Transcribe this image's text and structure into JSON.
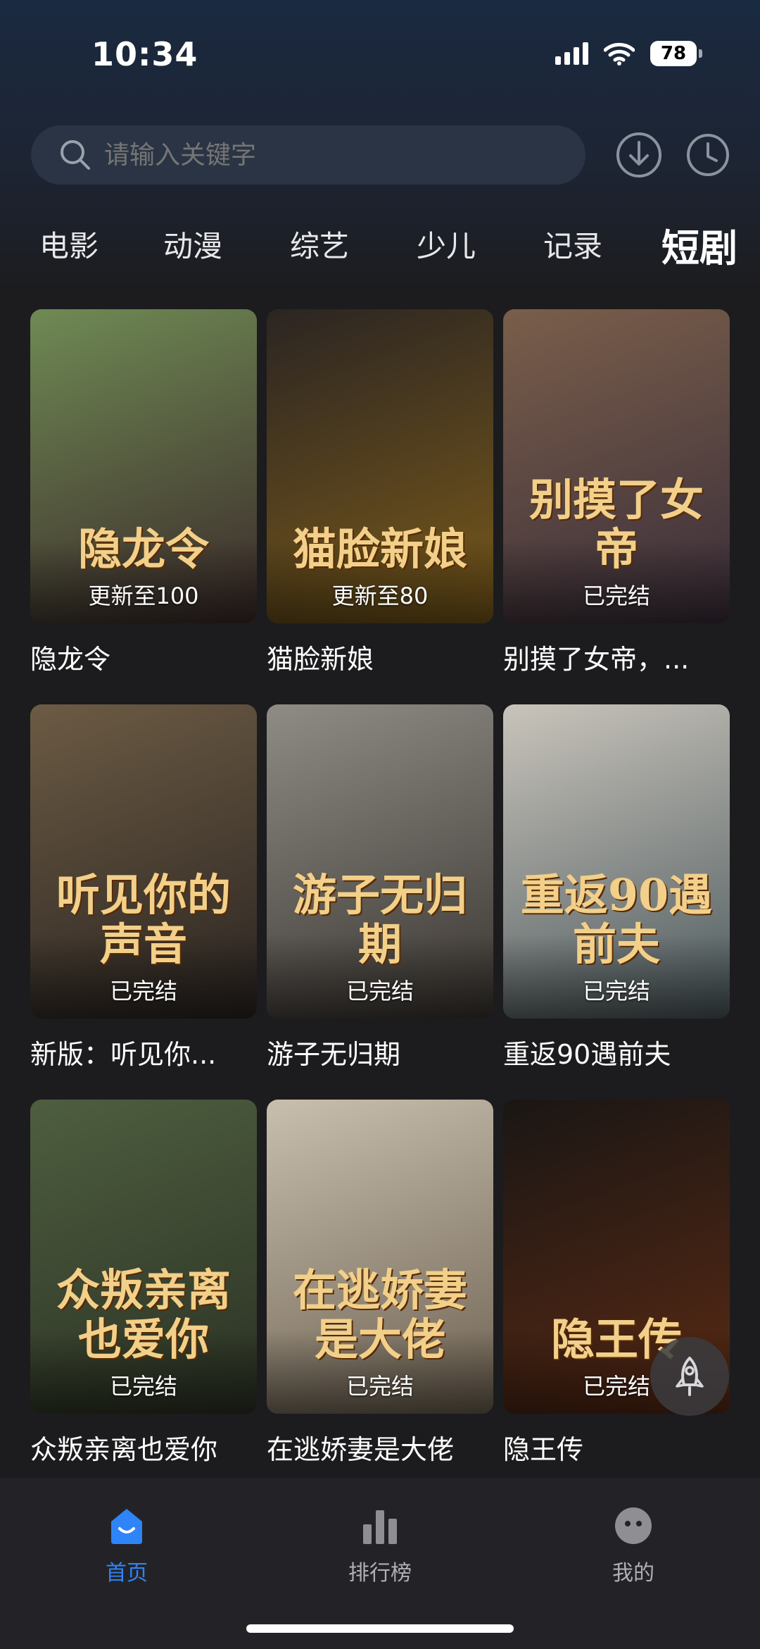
{
  "status_bar": {
    "time": "10:34",
    "battery": "78"
  },
  "search": {
    "placeholder": "请输入关键字"
  },
  "categories": [
    "电影",
    "动漫",
    "综艺",
    "少儿",
    "记录",
    "短剧"
  ],
  "active_category": "短剧",
  "items": [
    {
      "title": "隐龙令",
      "badge": "更新至100",
      "art": "隐龙令",
      "colors": [
        "#6f8a54",
        "#3b2a2a"
      ]
    },
    {
      "title": "猫脸新娘",
      "badge": "更新至80",
      "art": "猫脸新娘",
      "colors": [
        "#2b2522",
        "#7a5a1a"
      ]
    },
    {
      "title": "别摸了女帝，...",
      "badge": "已完结",
      "art": "别摸了女帝",
      "colors": [
        "#7a5e4a",
        "#3a2e3a"
      ]
    },
    {
      "title": "新版：听见你...",
      "badge": "已完结",
      "art": "听见你的声音",
      "colors": [
        "#6c5b44",
        "#2a2421"
      ]
    },
    {
      "title": "游子无归期",
      "badge": "已完结",
      "art": "游子无归期",
      "colors": [
        "#8f8c86",
        "#3a3530"
      ]
    },
    {
      "title": "重返90遇前夫",
      "badge": "已完结",
      "art": "重返90遇前夫",
      "colors": [
        "#c9c4bb",
        "#4d5a5e"
      ]
    },
    {
      "title": "众叛亲离也爱你",
      "badge": "已完结",
      "art": "众叛亲离也爱你",
      "colors": [
        "#4e5e3f",
        "#2b3224"
      ]
    },
    {
      "title": "在逃娇妻是大佬",
      "badge": "已完结",
      "art": "在逃娇妻是大佬",
      "colors": [
        "#c8bfae",
        "#6e6252"
      ]
    },
    {
      "title": "隐王传",
      "badge": "已完结",
      "art": "隐王传",
      "colors": [
        "#1a1614",
        "#5a2a14"
      ]
    }
  ],
  "tabs": [
    {
      "label": "首页",
      "icon": "home-icon",
      "active": true
    },
    {
      "label": "排行榜",
      "icon": "ranking-icon",
      "active": false
    },
    {
      "label": "我的",
      "icon": "profile-icon",
      "active": false
    }
  ],
  "colors": {
    "accent": "#2f84f7",
    "background": "#1c1c1e"
  }
}
